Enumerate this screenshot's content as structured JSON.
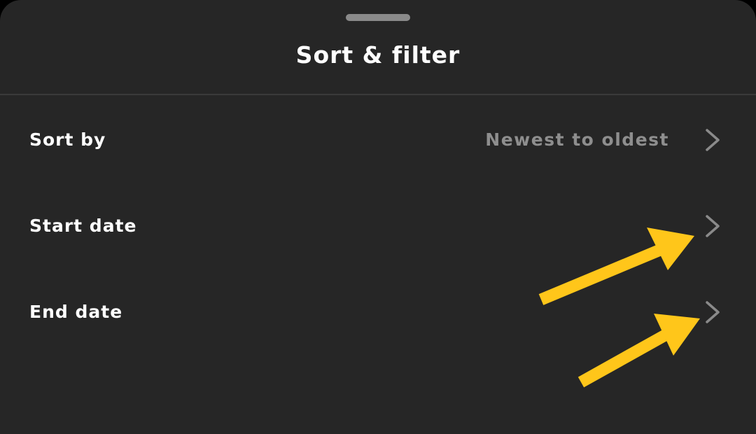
{
  "sheet": {
    "title": "Sort & filter"
  },
  "rows": [
    {
      "label": "Sort by",
      "value": "Newest to oldest",
      "icon": "chevron-right-icon"
    },
    {
      "label": "Start date",
      "value": "",
      "icon": "chevron-right-icon"
    },
    {
      "label": "End date",
      "value": "",
      "icon": "chevron-right-icon"
    }
  ],
  "colors": {
    "background": "#262626",
    "text_primary": "#ffffff",
    "text_secondary": "#8e8e8e",
    "annotation_arrow": "#FFC61A"
  },
  "annotations": {
    "icon": "arrow-icon",
    "count": 2
  }
}
